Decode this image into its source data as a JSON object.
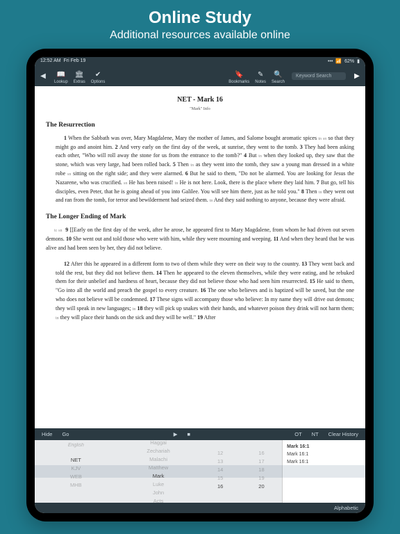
{
  "hero": {
    "title": "Online Study",
    "subtitle": "Additional resources available online"
  },
  "status": {
    "time": "12:52 AM",
    "date": "Fri Feb 19",
    "battery": "62%"
  },
  "topbar": {
    "lookup": "Lookup",
    "extras": "Extras",
    "options": "Options",
    "bookmarks": "Bookmarks",
    "notes": "Notes",
    "search": "Search",
    "keyword": "Keyword Search"
  },
  "doc": {
    "title": "NET - Mark 16",
    "subtitle": "\"Mark\" Info",
    "h1": "The Resurrection",
    "p1a": "1",
    "p1": " When the Sabbath was over, Mary Magdalene, Mary the mother of James, and Salome bought aromatic spices ",
    "p1b": "tn  sn",
    "p1c": " so that they might go and anoint him.    ",
    "p2a": "2",
    "p2": " And very early on the first day of the week, at sunrise, they went to the tomb.    ",
    "p3a": "3",
    "p3": " They had been asking each other, \"Who will roll away the stone for us from the entrance to the tomb?\"    ",
    "p4a": "4",
    "p4b": " But ",
    "p4m": "tn",
    "p4": " when they looked up, they saw that the stone, which was very large, had been rolled back.    ",
    "p5a": "5",
    "p5b": " Then ",
    "p5m": "tn",
    "p5": " as they went into the tomb, they saw a young man dressed in a white robe ",
    "p5m2": "sn",
    "p5c": " sitting on the right side; and they were alarmed.    ",
    "p6a": "6",
    "p6": " But he said to them, \"Do not be alarmed. You are looking for Jesus the Nazarene, who was crucified. ",
    "p6m": "sn",
    "p6b": " He has been raised! ",
    "p6m2": "tn",
    "p6c": " He is not here. Look, there is the place where they laid him.    ",
    "p7a": "7",
    "p7": " But go, tell his disciples, even Peter, that he is going ahead of you into Galilee. You will see him there, just as he told you.\"    ",
    "p8a": "8",
    "p8b": " Then ",
    "p8m": "tn",
    "p8": " they went out and ran from the tomb, for terror and bewilderment had seized them. ",
    "p8m2": "tn",
    "p8c": " And they said nothing to anyone, because they were afraid.",
    "h2": "The Longer Ending of Mark",
    "p9m": "tc  sn",
    "p9a": "9",
    "p9": " [[Early on the first day of the week, after he arose, he appeared first to Mary Magdalene, from whom he had driven out seven demons.    ",
    "p10a": "10",
    "p10": " She went out and told those who were with him, while they were mourning and weeping.    ",
    "p11a": "11",
    "p11": " And when they heard that he was alive and had been seen by her, they did not believe.",
    "p12a": "12",
    "p12": " After this he appeared in a different form to two of them while they were on their way to the country.    ",
    "p13a": "13",
    "p13": " They went back and told the rest, but they did not believe them.    ",
    "p14a": "14",
    "p14": " Then he appeared to the eleven themselves, while they were eating, and he rebuked them for their unbelief and hardness of heart, because they did not believe those who had seen him resurrected.    ",
    "p15a": "15",
    "p15": " He said to them, \"Go into all the world and preach the gospel to every creature.    ",
    "p16a": "16",
    "p16": " The one who believes and is baptized will be saved, but the one who does not believe will be condemned.    ",
    "p17a": "17",
    "p17": " These signs will accompany those who believe: In my name they will drive out demons; they will speak in new languages; ",
    "p17m": "tn",
    "p17b": "    ",
    "p18a": "18",
    "p18": " they will pick up snakes with their hands, and whatever poison they drink will not harm them; ",
    "p18m": "tn",
    "p18b": " they will place their hands on the sick and they will be well.\"    ",
    "p19a": "19",
    "p19": " After"
  },
  "navstrip": {
    "hide": "Hide",
    "go": "Go",
    "ot": "OT",
    "nt": "NT",
    "clear": "Clear History"
  },
  "picker": {
    "english": "English",
    "versions": [
      "",
      "NET",
      "KJV",
      "WEB",
      "MHB"
    ],
    "books": [
      "Haggai",
      "Zechariah",
      "Malachi",
      "Matthew",
      "Mark",
      "Luke",
      "John",
      "Acts",
      ""
    ],
    "ch": [
      "12",
      "13",
      "14",
      "15",
      "16",
      "",
      ""
    ],
    "vs": [
      "16",
      "17",
      "18",
      "19",
      "20",
      "",
      "",
      ""
    ],
    "hist": [
      "Mark 16:1",
      "Mark 16:1",
      "Mark 16:1"
    ]
  },
  "bottom": {
    "alpha": "Alphabetic"
  }
}
